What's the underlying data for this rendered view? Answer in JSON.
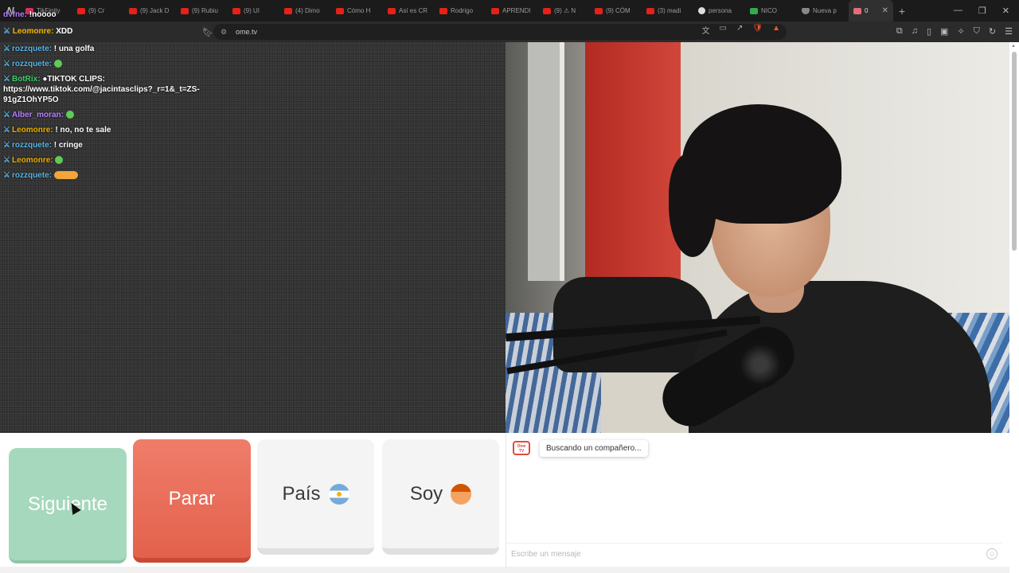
{
  "browser": {
    "tabs": [
      {
        "label": "TikFinity",
        "icon": "tiktok"
      },
      {
        "label": "(9) Cr",
        "icon": "youtube"
      },
      {
        "label": "(9) Jack D",
        "icon": "youtube"
      },
      {
        "label": "(9) Rubiu",
        "icon": "youtube"
      },
      {
        "label": "(9) UI",
        "icon": "youtube"
      },
      {
        "label": "(4) Dimo",
        "icon": "youtube"
      },
      {
        "label": "Cómo H",
        "icon": "youtube"
      },
      {
        "label": "Así es CR",
        "icon": "youtube"
      },
      {
        "label": "Rodrigo",
        "icon": "youtube"
      },
      {
        "label": "APRENDI",
        "icon": "youtube"
      },
      {
        "label": "(9) ⚠ N",
        "icon": "youtube"
      },
      {
        "label": "(9) CÓM",
        "icon": "youtube"
      },
      {
        "label": "(3) madi",
        "icon": "youtube"
      },
      {
        "label": "persona",
        "icon": "google"
      },
      {
        "label": "NICO",
        "icon": "green"
      },
      {
        "label": "Nueva p",
        "icon": "shield"
      }
    ],
    "active_tab": {
      "label": "0"
    },
    "url": "ome.tv"
  },
  "stream_overlay": {
    "top_user": "dvfne:",
    "top_text": "!noooo",
    "first_user": "Leomonre:",
    "first_text": "XDD"
  },
  "chat": {
    "messages": [
      {
        "user": "rozzquete:",
        "text": "! una golfa",
        "color": "u-blue"
      },
      {
        "user": "rozzquete:",
        "text": "",
        "color": "u-blue",
        "emoji": true
      },
      {
        "user": "BotRix:",
        "text": "●TIKTOK CLIPS: https://www.tiktok.com/@jacintasclips?_r=1&_t=ZS-91gZ1OhYP5O",
        "color": "u-green"
      },
      {
        "user": "Alber_moran:",
        "text": "",
        "color": "u-purple",
        "emoji": true
      },
      {
        "user": "Leomonre:",
        "text": "! no, no te sale",
        "color": "u-yellow"
      },
      {
        "user": "rozzquete:",
        "text": "! cringe",
        "color": "u-blue"
      },
      {
        "user": "Leomonre:",
        "text": "",
        "color": "u-yellow",
        "emoji": true
      },
      {
        "user": "rozzquete:",
        "text": "",
        "color": "u-blue",
        "emoji": "hot"
      }
    ]
  },
  "controls": {
    "next_label": "Siguiente",
    "stop_label": "Parar",
    "country_label": "País",
    "gender_label": "Soy"
  },
  "text_chat": {
    "logo": "Ome TV",
    "status": "Buscando un compañero...",
    "input_placeholder": "Escribe un mensaje"
  }
}
